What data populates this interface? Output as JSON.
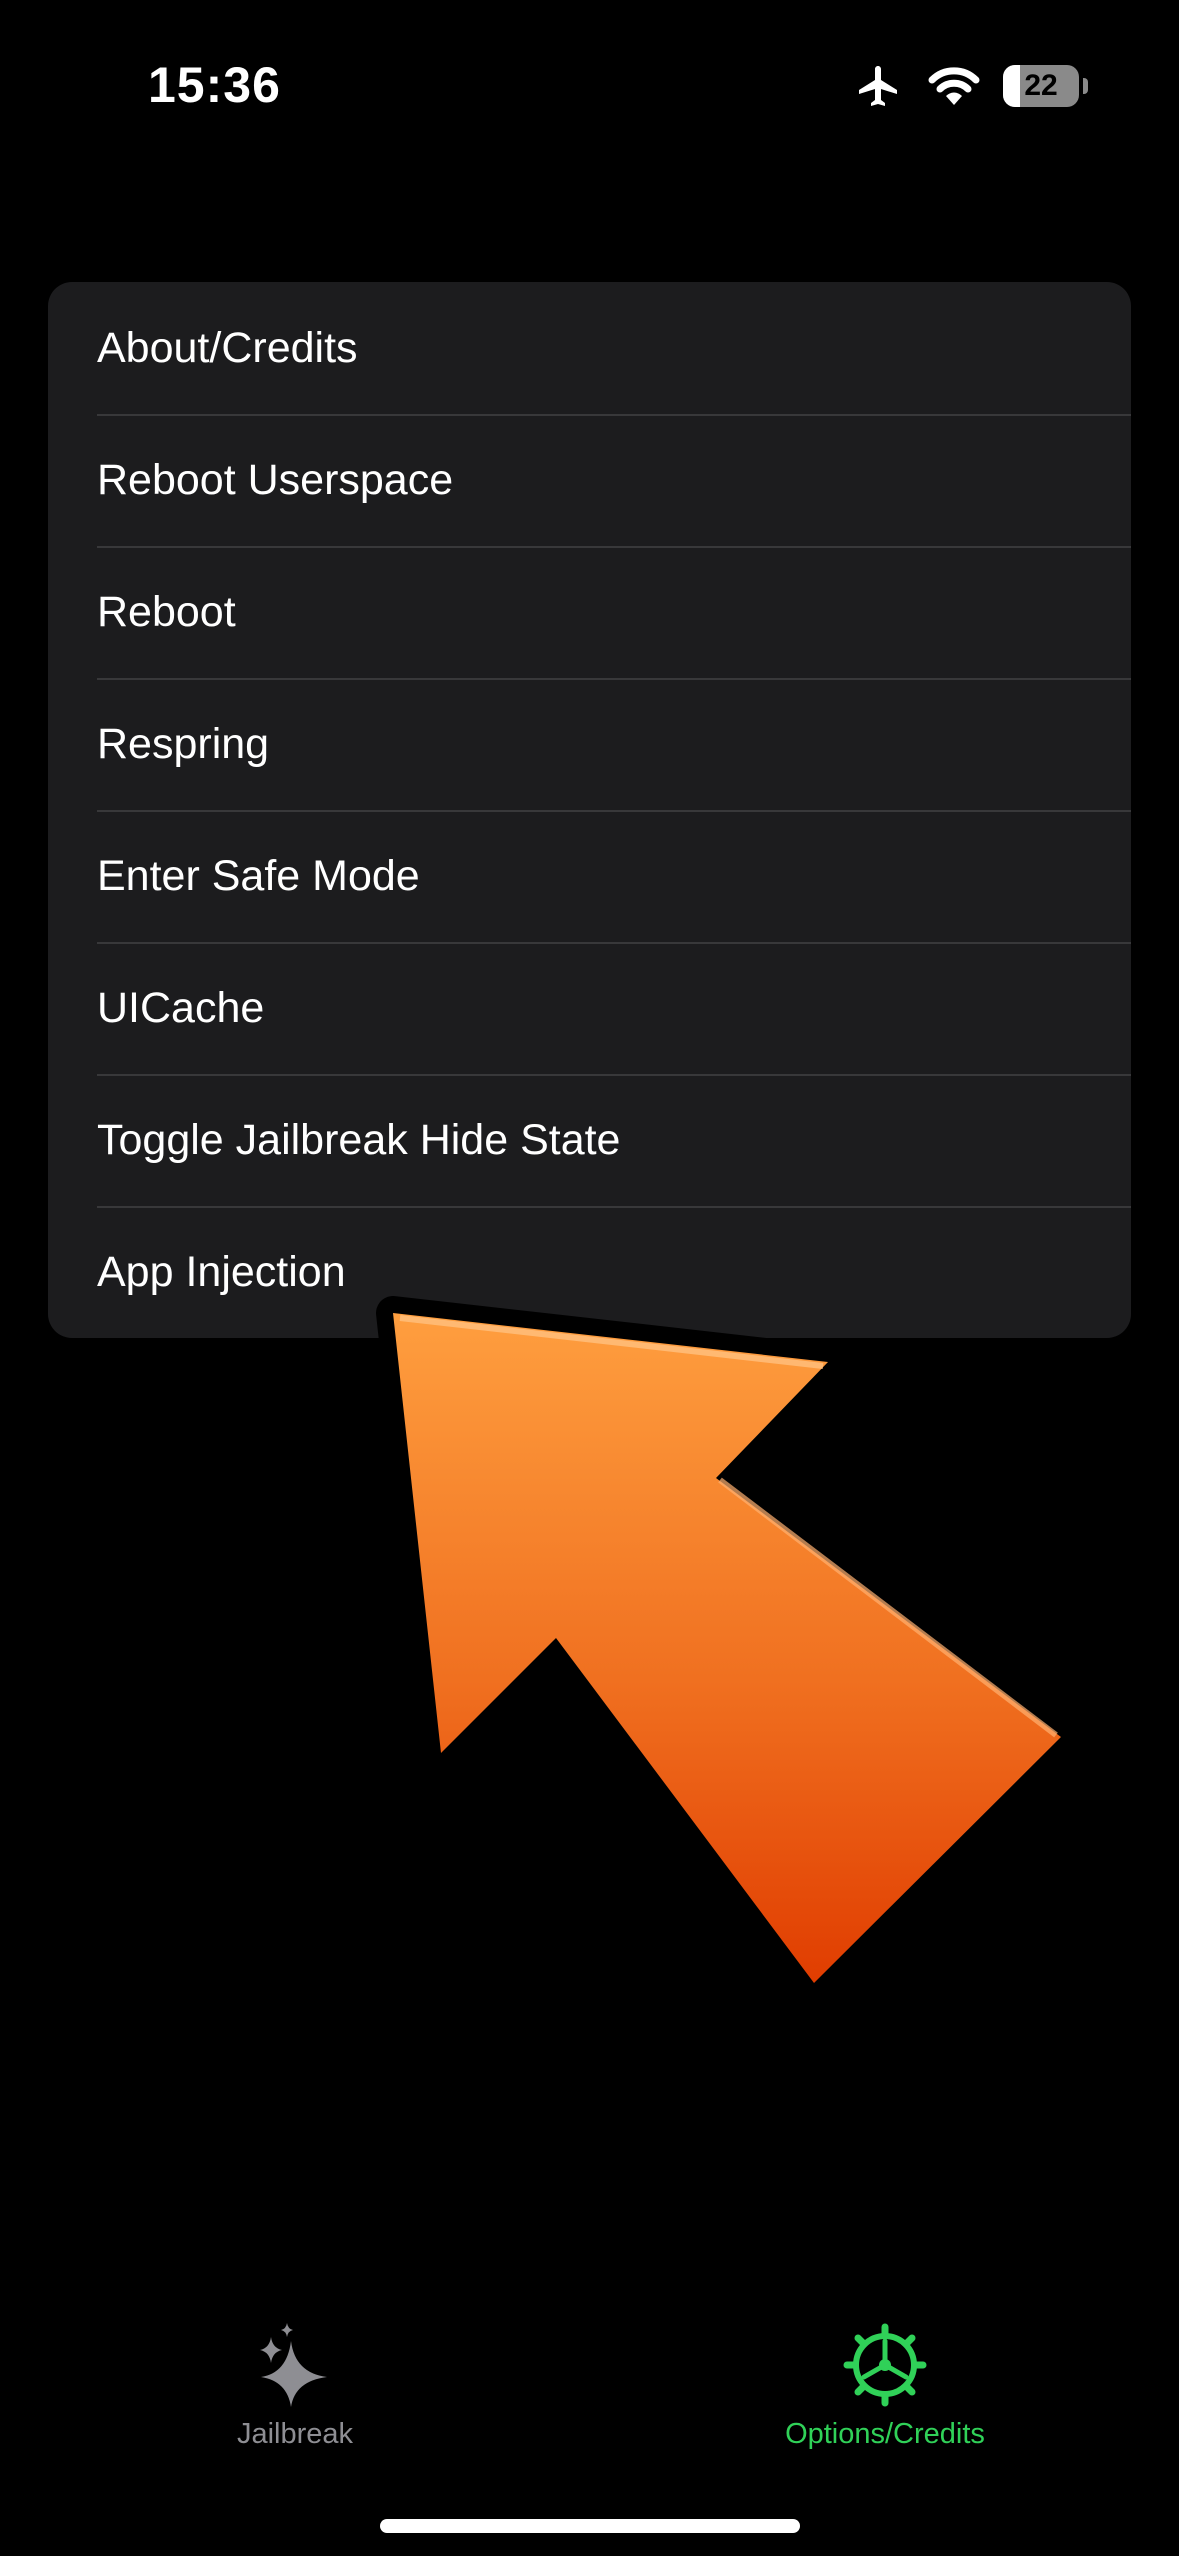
{
  "status_bar": {
    "time": "15:36",
    "battery_level": "22",
    "icons": [
      "airplane-icon",
      "wifi-icon",
      "battery-icon"
    ]
  },
  "options": [
    {
      "label": "About/Credits"
    },
    {
      "label": "Reboot Userspace"
    },
    {
      "label": "Reboot"
    },
    {
      "label": "Respring"
    },
    {
      "label": "Enter Safe Mode"
    },
    {
      "label": "UICache"
    },
    {
      "label": "Toggle Jailbreak Hide State"
    },
    {
      "label": "App Injection"
    }
  ],
  "annotation": {
    "icon": "orange-arrow-icon",
    "color_top": "#ffa040",
    "color_bottom": "#e03c00"
  },
  "tab_bar": {
    "tabs": [
      {
        "label": "Jailbreak",
        "icon": "sparkles-icon",
        "selected": false
      },
      {
        "label": "Options/Credits",
        "icon": "gear-icon",
        "selected": true
      }
    ],
    "active_color": "#30d158",
    "inactive_color": "#8e8e93"
  },
  "colors": {
    "background": "#000000",
    "card": "#1c1c1e",
    "separator": "#38383a"
  }
}
